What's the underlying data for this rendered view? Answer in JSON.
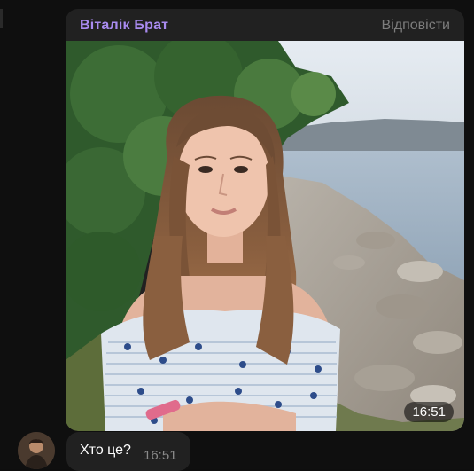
{
  "photo_message": {
    "sender": "Віталік Брат",
    "reply_label": "Відповісти",
    "time": "16:51"
  },
  "text_message": {
    "text": "Хто це?",
    "time": "16:51"
  },
  "colors": {
    "background": "#0f0f0f",
    "bubble": "#212121",
    "sender_name": "#a98bf0"
  }
}
